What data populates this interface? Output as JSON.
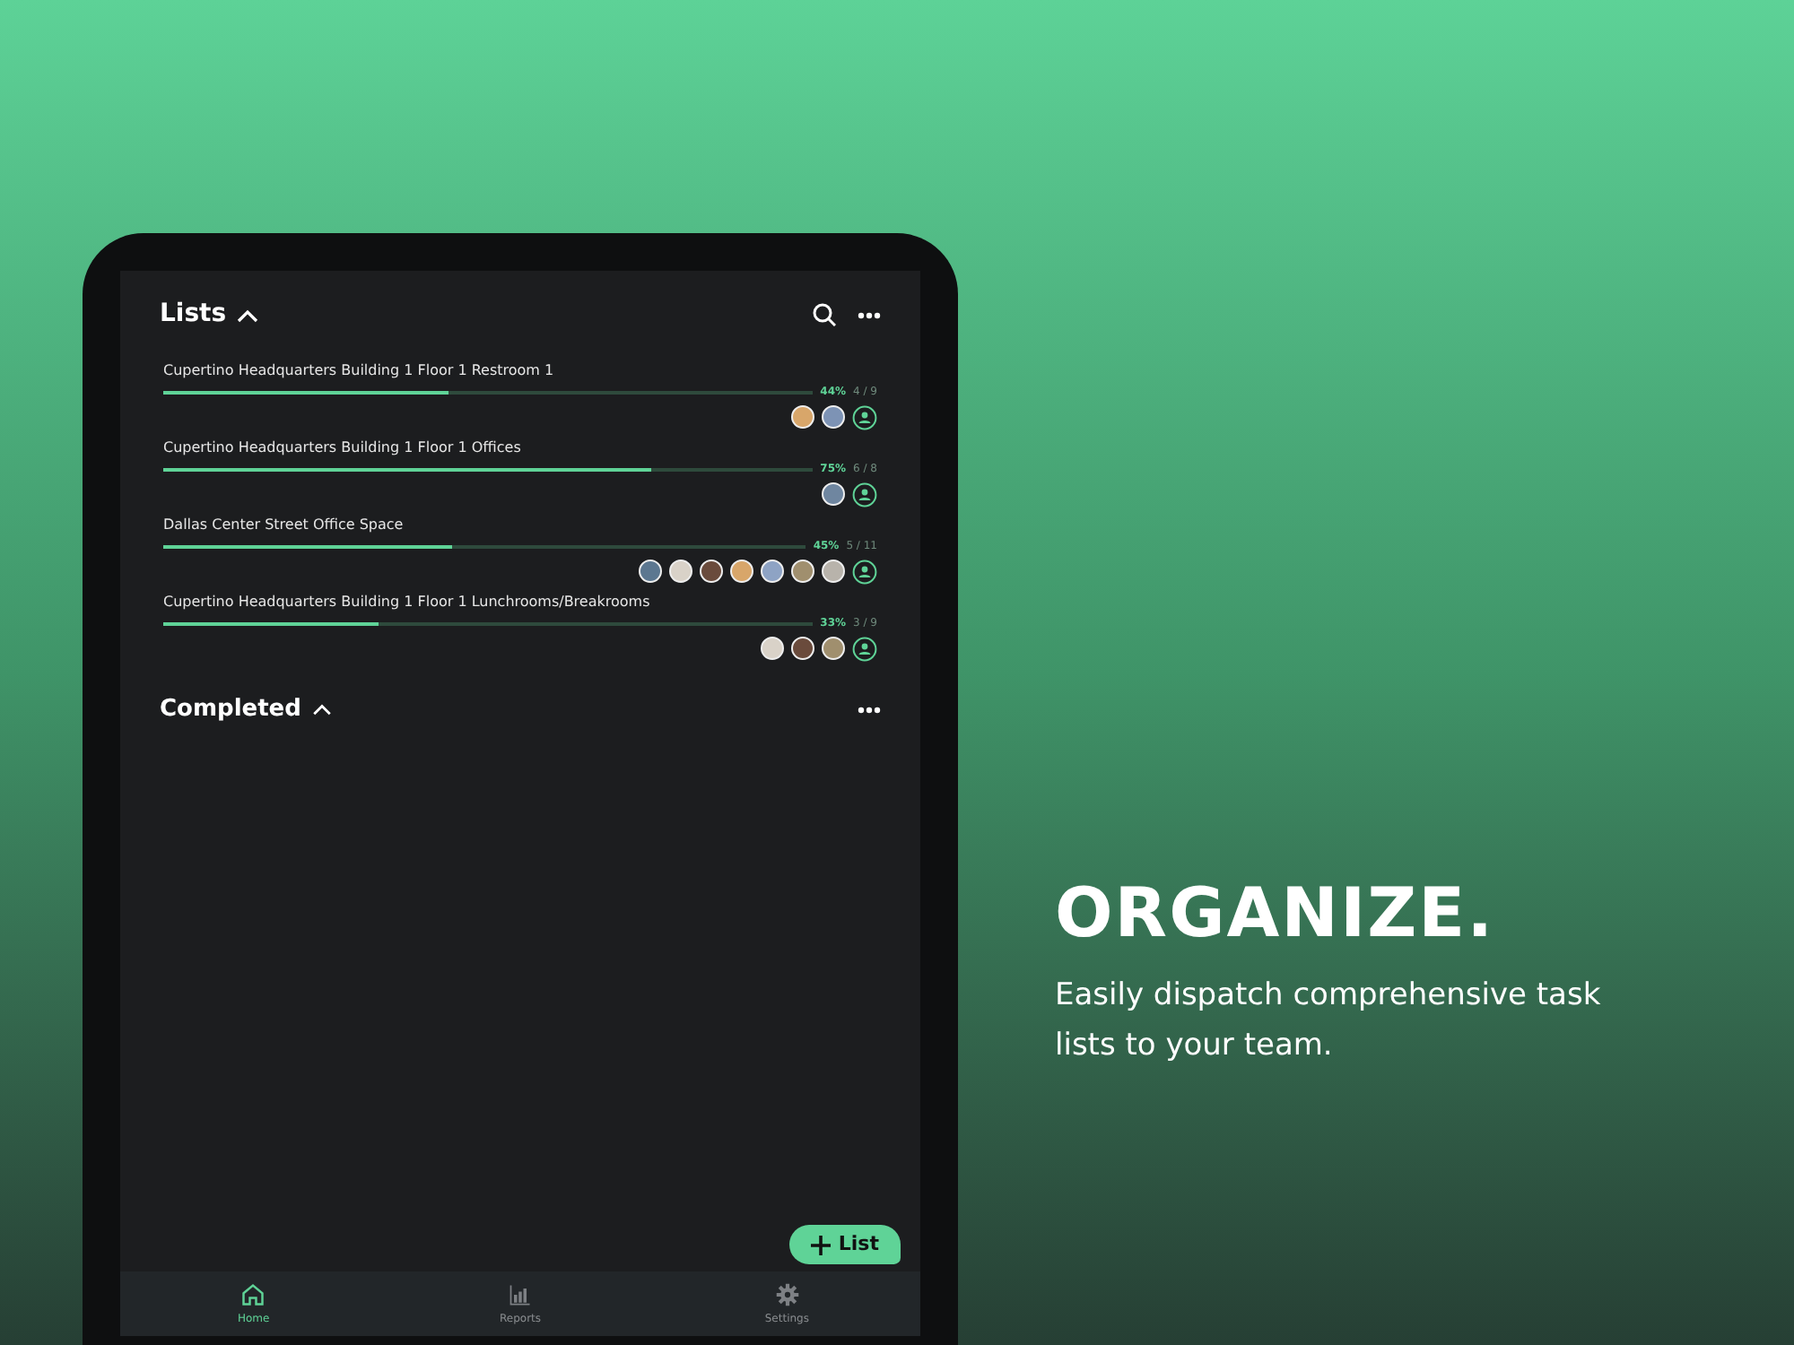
{
  "header": {
    "title": "Lists",
    "expanded": true
  },
  "lists": [
    {
      "name": "Cupertino Headquarters Building 1 Floor 1 Restroom 1",
      "level": 0.44,
      "percent": "44%",
      "count": "4 / 9",
      "avatars": [
        {
          "color": "#d8a66a"
        },
        {
          "color": "#7d93b5"
        }
      ]
    },
    {
      "name": "Cupertino Headquarters Building 1 Floor 1 Offices",
      "level": 0.75,
      "percent": "75%",
      "count": "6 / 8",
      "avatars": [
        {
          "color": "#6f86a0"
        }
      ]
    },
    {
      "name": "Dallas Center Street Office Space",
      "level": 0.45,
      "percent": "45%",
      "count": "5 / 11",
      "avatars": [
        {
          "color": "#5c7790"
        },
        {
          "color": "#d9d2c8"
        },
        {
          "color": "#6a4b3c"
        },
        {
          "color": "#d8a66a"
        },
        {
          "color": "#8ea3c4"
        },
        {
          "color": "#a08f6e"
        },
        {
          "color": "#b8b3ab"
        }
      ]
    },
    {
      "name": "Cupertino Headquarters Building 1 Floor 1 Lunchrooms/Breakrooms",
      "level": 0.33,
      "percent": "33%",
      "count": "3 / 9",
      "avatars": [
        {
          "color": "#d9d2c8"
        },
        {
          "color": "#6a4b3c"
        },
        {
          "color": "#a08f6e"
        }
      ]
    }
  ],
  "completed": {
    "title": "Completed",
    "expanded": true
  },
  "add_button": "List",
  "nav": [
    {
      "label": "Home",
      "kind": "home",
      "selected": true
    },
    {
      "label": "Reports",
      "kind": "reports",
      "selected": false
    },
    {
      "label": "Settings",
      "kind": "settings",
      "selected": false
    }
  ],
  "promo": {
    "heading": "ORGANIZE.",
    "text": "Easily dispatch comprehensive task lists to your team."
  }
}
